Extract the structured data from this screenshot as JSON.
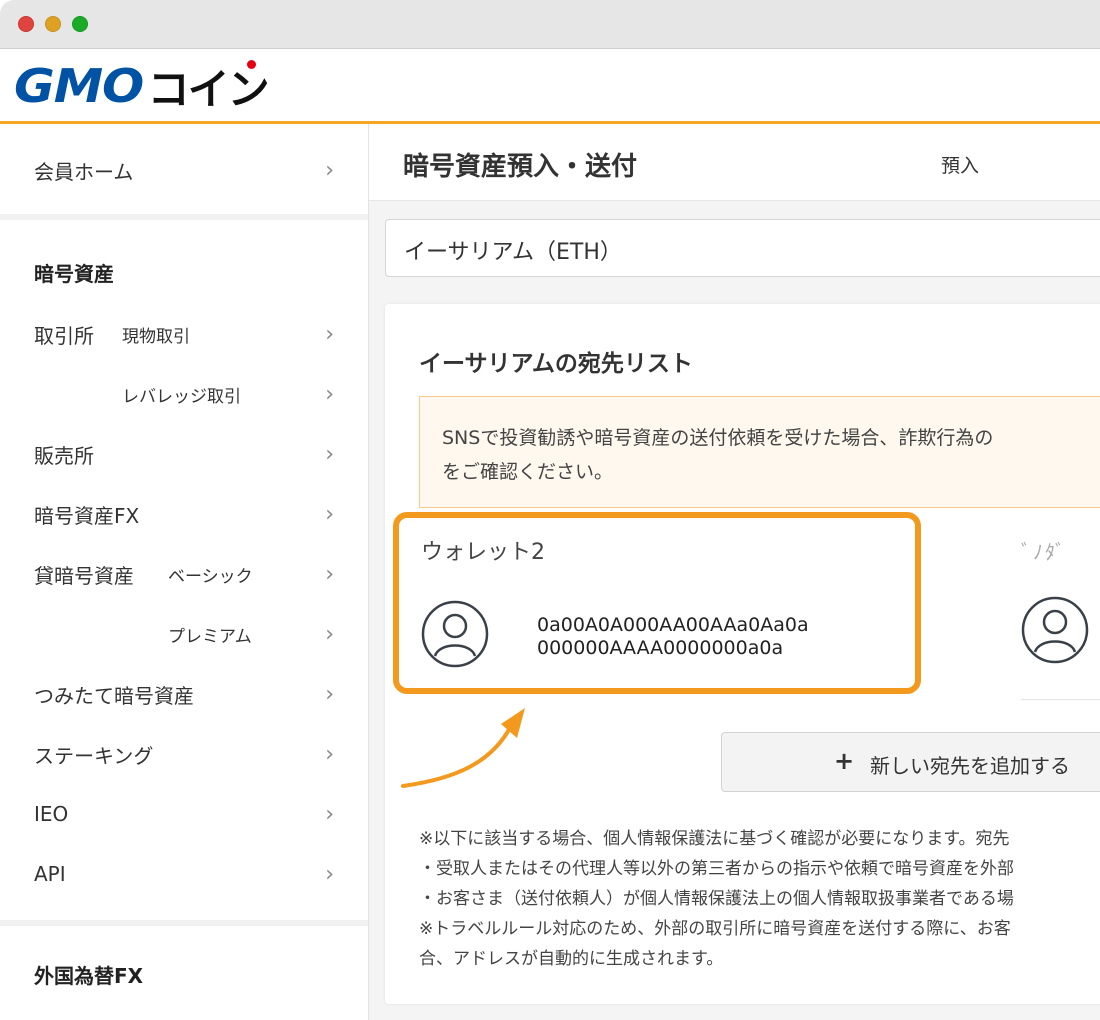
{
  "window": {
    "controls": [
      "close",
      "minimize",
      "maximize"
    ]
  },
  "header": {
    "logo_gmo": "GMO",
    "logo_coin": "コイン"
  },
  "sidebar": {
    "home": "会員ホーム",
    "section_crypto": "暗号資産",
    "items": [
      {
        "label": "取引所",
        "sub": "現物取引"
      },
      {
        "label": "",
        "sub": "レバレッジ取引"
      },
      {
        "label": "販売所",
        "sub": ""
      },
      {
        "label": "暗号資産FX",
        "sub": ""
      },
      {
        "label": "貸暗号資産",
        "sub": "ベーシック"
      },
      {
        "label": "",
        "sub": "プレミアム"
      },
      {
        "label": "つみたて暗号資産",
        "sub": ""
      },
      {
        "label": "ステーキング",
        "sub": ""
      },
      {
        "label": "IEO",
        "sub": ""
      },
      {
        "label": "API",
        "sub": ""
      }
    ],
    "section_fx": "外国為替FX",
    "chevron": "›"
  },
  "main": {
    "title": "暗号資産預入・送付",
    "tab_deposit": "預入",
    "currency_select": "イーサリアム（ETH）",
    "card": {
      "title": "イーサリアムの宛先リスト",
      "warning_line1": "SNSで投資勧誘や暗号資産の送付依頼を受けた場合、詐欺行為の",
      "warning_line2": "をご確認ください。",
      "wallet": {
        "name": "ウォレット2",
        "address_line1": "0a00A0A000AA00AAa0Aa0a",
        "address_line2": "000000AAAA0000000a0a"
      },
      "wallet2_name": "ﾞﾉﾀﾞ",
      "add_button": {
        "icon": "+",
        "label": "新しい宛先を追加する"
      },
      "notes": [
        "※以下に該当する場合、個人情報保護法に基づく確認が必要になります。宛先",
        "・受取人またはその代理人等以外の第三者からの指示や依頼で暗号資産を外部",
        "・お客さま（送付依頼人）が個人情報保護法上の個人情報取扱事業者である場",
        "※トラベルルール対応のため、外部の取引所に暗号資産を送付する際に、お客",
        "合、アドレスが自動的に生成されます。"
      ]
    }
  },
  "colors": {
    "accent_orange": "#f39a1e",
    "brand_blue": "#0052a5",
    "brand_red": "#e60012"
  }
}
